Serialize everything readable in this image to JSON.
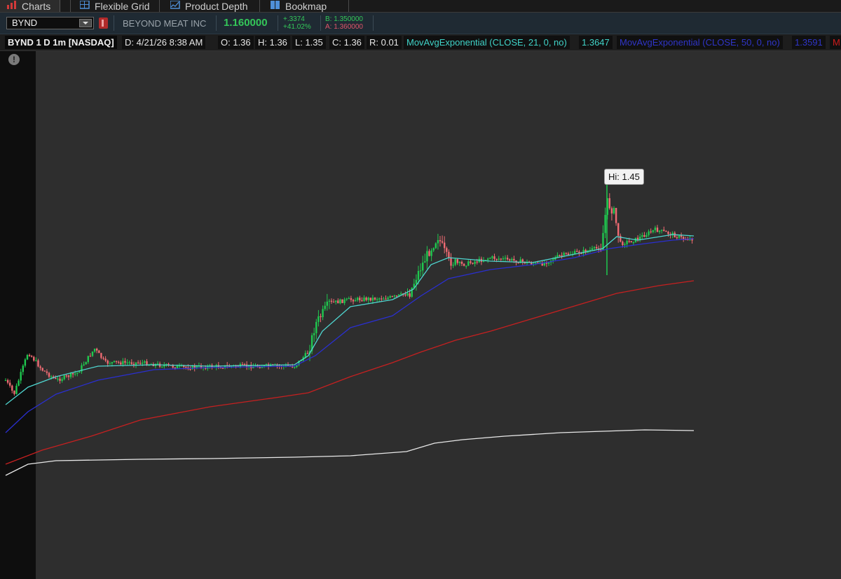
{
  "tabs": [
    {
      "label": "Charts",
      "icon": "bar-chart-icon",
      "active": true
    },
    {
      "label": "Flexible Grid",
      "icon": "grid-icon",
      "active": false
    },
    {
      "label": "Product Depth",
      "icon": "depth-icon",
      "active": false
    },
    {
      "label": "Bookmap",
      "icon": "bookmap-icon",
      "active": false
    }
  ],
  "symbol_bar": {
    "symbol": "BYND",
    "company": "BEYOND MEAT INC",
    "last": "1.160000",
    "change": "+.3374",
    "change_pct": "+41.02%",
    "bid": "B: 1.350000",
    "ask": "A: 1.360000",
    "colors": {
      "up": "#34c759",
      "down": "#e0556a"
    }
  },
  "header": {
    "symbol_desc": "BYND 1 D 1m [NASDAQ]",
    "date": "D: 4/21/26 8:38 AM",
    "open": "O: 1.36",
    "high": "H: 1.36",
    "low": "L: 1.35",
    "close": "C: 1.36",
    "range": "R: 0.01",
    "ma21_label": "MovAvgExponential (CLOSE, 21, 0, no)",
    "ma21_value": "1.3647",
    "ma50_label": "MovAvgExponential (CLOSE, 50, 0, no)",
    "ma50_value": "1.3591",
    "ma_more": "M"
  },
  "chart": {
    "hi_label": "Hi: 1.45",
    "alert_icon": "!",
    "colors": {
      "up": "#1fc94f",
      "down": "#ef6b73",
      "ema21": "#4fd6d0",
      "ema50": "#2a2fd0",
      "ema200": "#c62020",
      "ema_long": "#e8e8e8",
      "bg": "#2e2e2e",
      "premarket": "#0e0e0e"
    }
  }
}
